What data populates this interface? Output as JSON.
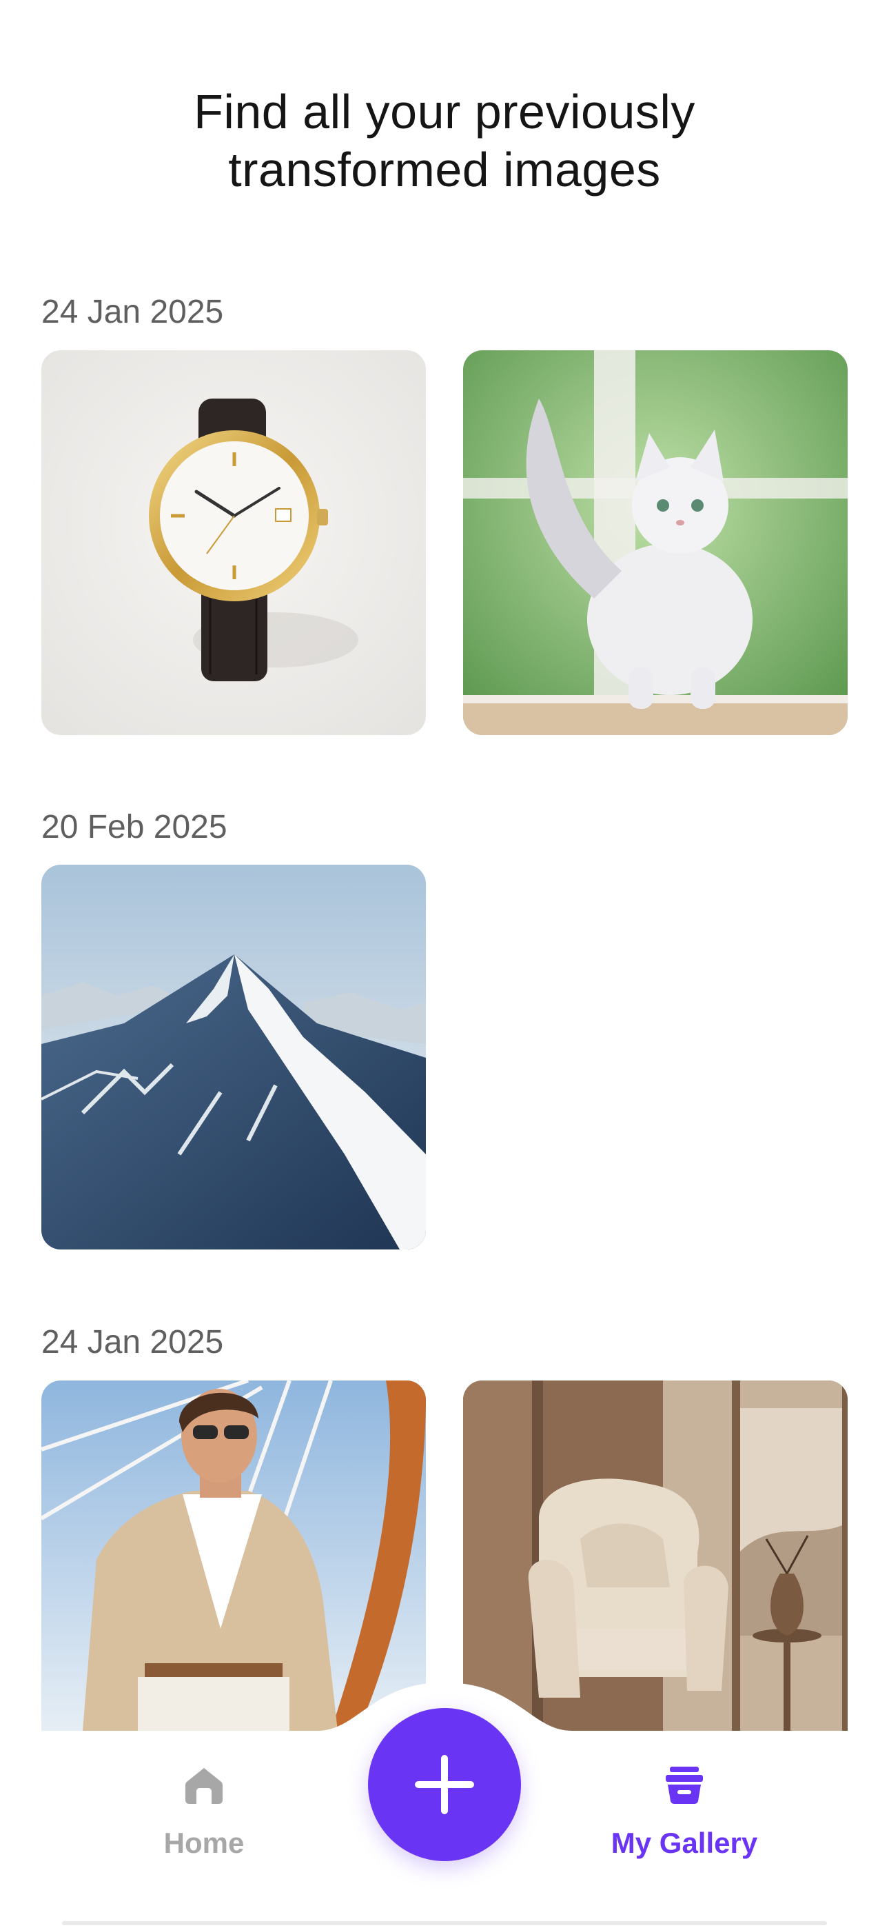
{
  "header": {
    "title_line1": "Find all your previously",
    "title_line2": "transformed images"
  },
  "gallery": {
    "groups": [
      {
        "date": "24 Jan 2025",
        "images": [
          "watch-image",
          "cat-image"
        ]
      },
      {
        "date": "20 Feb 2025",
        "images": [
          "mountain-image"
        ]
      },
      {
        "date": "24 Jan 2025",
        "images": [
          "man-portrait-image",
          "armchair-image"
        ]
      }
    ]
  },
  "tabbar": {
    "home_label": "Home",
    "home_icon": "house-icon",
    "gallery_label": "My Gallery",
    "gallery_icon": "archive-box-icon",
    "add_icon": "plus-icon",
    "active_color": "#6a34f5",
    "inactive_color": "#a7a7a7"
  }
}
